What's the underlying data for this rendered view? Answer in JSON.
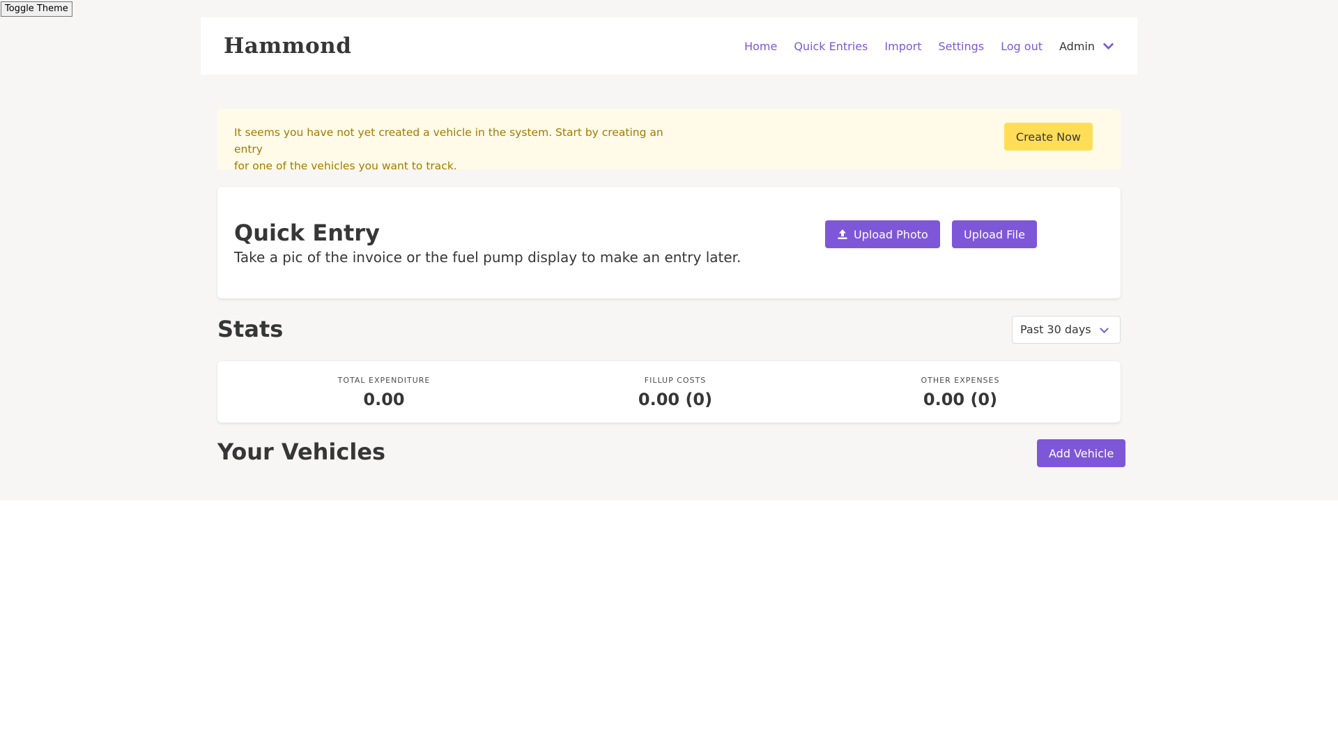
{
  "toggle_theme_label": "Toggle Theme",
  "navbar": {
    "brand": "Hammond",
    "links": [
      "Home",
      "Quick Entries",
      "Import",
      "Settings",
      "Log out"
    ],
    "user_label": "Admin"
  },
  "notice": {
    "text_line1": "It seems you have not yet created a vehicle in the system. Start by creating an entry",
    "text_line2": "for one of the vehicles you want to track.",
    "button_label": "Create Now"
  },
  "quick_entry": {
    "title": "Quick Entry",
    "subtitle": "Take a pic of the invoice or the fuel pump display to make an entry later.",
    "upload_photo_label": "Upload Photo",
    "upload_file_label": "Upload File"
  },
  "stats": {
    "title": "Stats",
    "period_selected": "Past 30 days",
    "items": [
      {
        "heading": "Total Expenditure",
        "value": "0.00"
      },
      {
        "heading": "Fillup Costs",
        "value": "0.00 (0)"
      },
      {
        "heading": "Other Expenses",
        "value": "0.00 (0)"
      }
    ]
  },
  "vehicles": {
    "title": "Your Vehicles",
    "add_button_label": "Add Vehicle"
  },
  "colors": {
    "primary": "#7e57d8",
    "warning": "#ffdd57",
    "notice_bg": "#fffbe8",
    "notice_text": "#a07a00",
    "page_bg": "#f7f6f4"
  },
  "icons": {
    "upload": "upload-icon",
    "user_dropdown": "chevron-down-icon",
    "select_dropdown": "chevron-down-icon"
  }
}
